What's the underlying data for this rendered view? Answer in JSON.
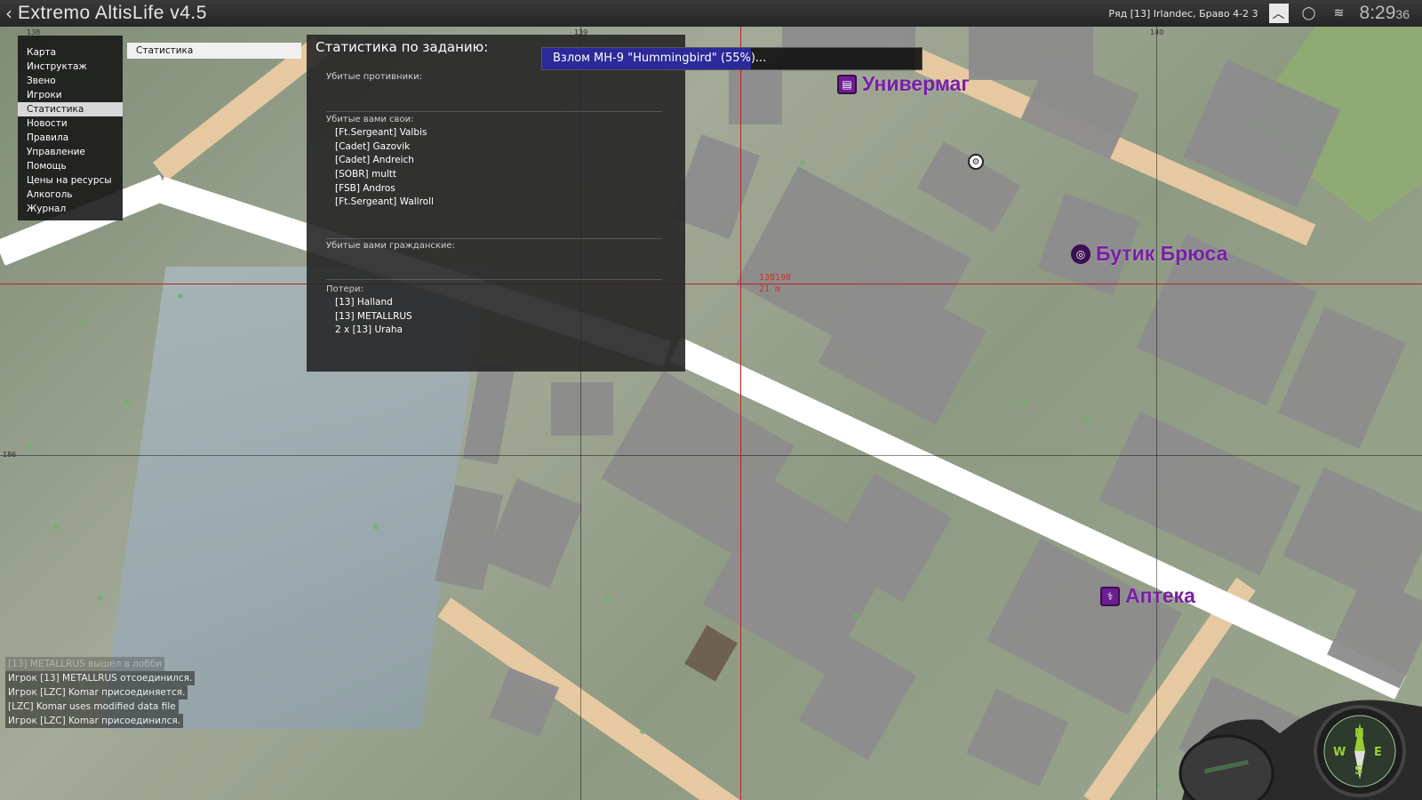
{
  "topbar": {
    "title": "Extremo AltisLife v4.5",
    "group": "Ряд [13] Irlandec, Браво 4-2 3",
    "clock_main": "8:29",
    "clock_seconds": "36"
  },
  "menu": {
    "items": [
      "Карта",
      "Инструктаж",
      "Звено",
      "Игроки",
      "Статистика",
      "Новости",
      "Правила",
      "Управление",
      "Помощь",
      "Цены на ресурсы",
      "Алкоголь",
      "Журнал"
    ],
    "active": "Статистика"
  },
  "subtab": "Статистика",
  "stats": {
    "header": "Статистика по заданию:",
    "enemies_label": "Убитые противники:",
    "friendly_label": "Убитые вами свои:",
    "friendly": [
      "[Ft.Sergeant] Valbis",
      "[Cadet] Gazovik",
      "[Cadet] Andreich",
      "[SOBR] multt",
      "[FSB] Andros",
      "[Ft.Sergeant] Wallroll"
    ],
    "civilians_label": "Убитые вами гражданские:",
    "losses_label": "Потери:",
    "losses": [
      "[13] Halland",
      "[13] METALLRUS",
      "2 x [13] Uraha"
    ]
  },
  "progress": {
    "text": "Взлом MH-9 \"Hummingbird\" (55%)...",
    "value": 0.55,
    "color": "#2b2a9a"
  },
  "map": {
    "markers": [
      {
        "label": "Универмаг",
        "icon": "store-icon"
      },
      {
        "label": "Бутик Брюса",
        "icon": "boutique-icon"
      },
      {
        "label": "Аптека",
        "icon": "pharmacy-icon"
      }
    ],
    "cursor_coords": "138198",
    "cursor_distance": "21 m",
    "grid_labels": {
      "x1": "138",
      "x2": "139",
      "x3": "140",
      "y1": "186"
    },
    "marker_color": "#7a1fa6"
  },
  "chat": [
    "[13] METALLRUS вышел в лобби",
    "Игрок [13] METALLRUS отсоединился.",
    "Игрок [LZC] Komar присоединяется.",
    "[LZC] Komar uses modified data file",
    "Игрок [LZC] Komar присоединился."
  ],
  "compass": {
    "n": "N",
    "e": "E",
    "s": "S",
    "w": "W"
  }
}
